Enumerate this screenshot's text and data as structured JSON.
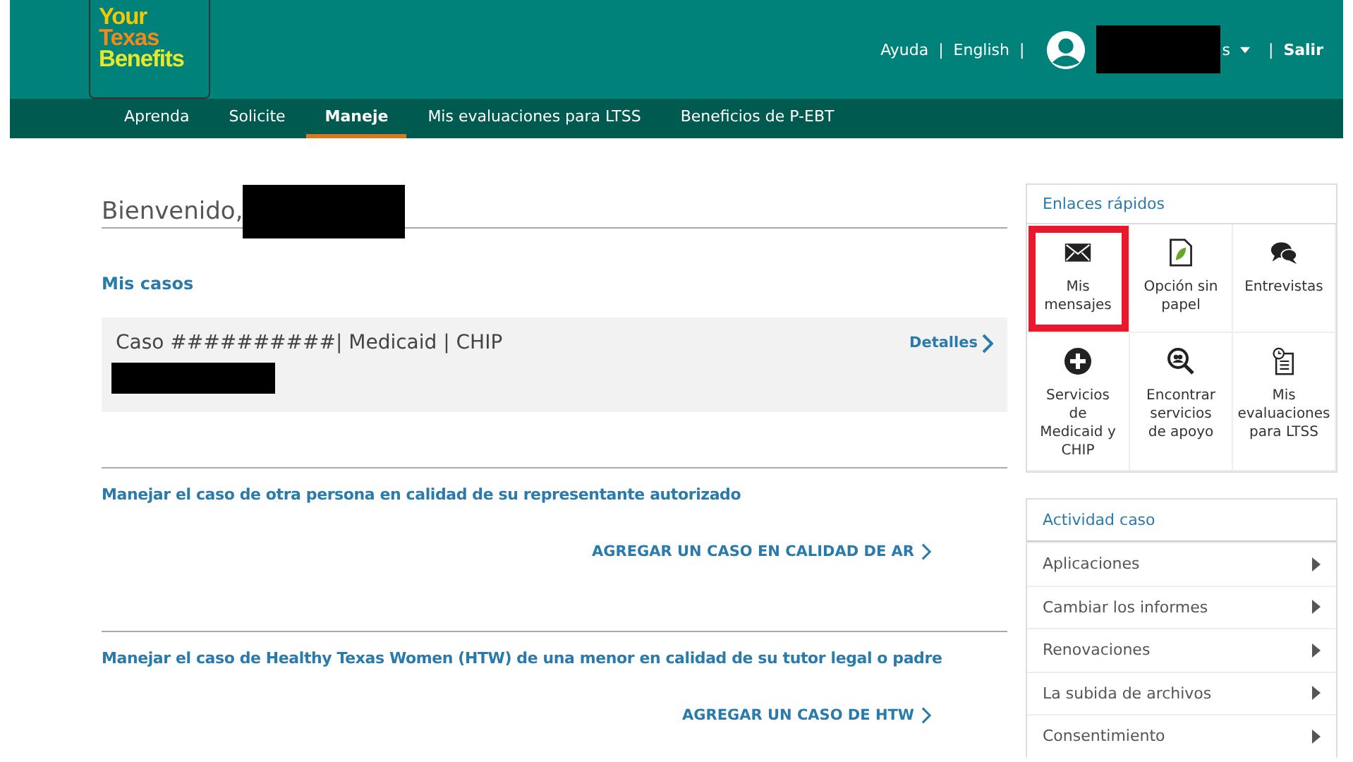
{
  "header": {
    "logo": [
      "Your",
      "Texas",
      "Benefits"
    ],
    "links": [
      "Ayuda",
      "English"
    ],
    "user_name_tail": "s",
    "logout": "Salir",
    "separator": "|"
  },
  "nav": [
    {
      "label": "Aprenda",
      "selected": false
    },
    {
      "label": "Solicite",
      "selected": false
    },
    {
      "label": "Maneje",
      "selected": true
    },
    {
      "label": "Mis evaluaciones para LTSS",
      "selected": false
    },
    {
      "label": "Beneficios de P-EBT",
      "selected": false
    }
  ],
  "welcome": "Bienvenido,",
  "cases": {
    "title": "Mis casos",
    "items": [
      {
        "title": "Caso ##########| Medicaid | CHIP",
        "link": "Detalles"
      }
    ]
  },
  "sections": [
    {
      "title": "Manejar el caso de otra persona en calidad de su representante autorizado",
      "action": "AGREGAR UN CASO EN CALIDAD DE AR"
    },
    {
      "title": "Manejar el caso de Healthy Texas Women (HTW) de una menor en calidad de su tutor legal o padre",
      "action": "AGREGAR UN CASO DE HTW"
    }
  ],
  "quick_links": {
    "title": "Enlaces rápidos",
    "items": [
      {
        "kind": "envelope",
        "label": "Mis mensajes",
        "highlighted": true
      },
      {
        "kind": "document",
        "label": "Opción sin papel",
        "highlighted": false
      },
      {
        "kind": "chat",
        "label": "Entrevistas",
        "highlighted": false
      },
      {
        "kind": "plus",
        "label": "Servicios de Medicaid y CHIP",
        "highlighted": false
      },
      {
        "kind": "search",
        "label": "Encontrar servicios de apoyo",
        "highlighted": false
      },
      {
        "kind": "clipboard",
        "label": "Mis evaluaciones para LTSS",
        "highlighted": false
      }
    ]
  },
  "case_activity": {
    "title": "Actividad caso",
    "items": [
      "Aplicaciones",
      "Cambiar los informes",
      "Renovaciones",
      "La subida de archivos",
      "Consentimiento"
    ]
  }
}
